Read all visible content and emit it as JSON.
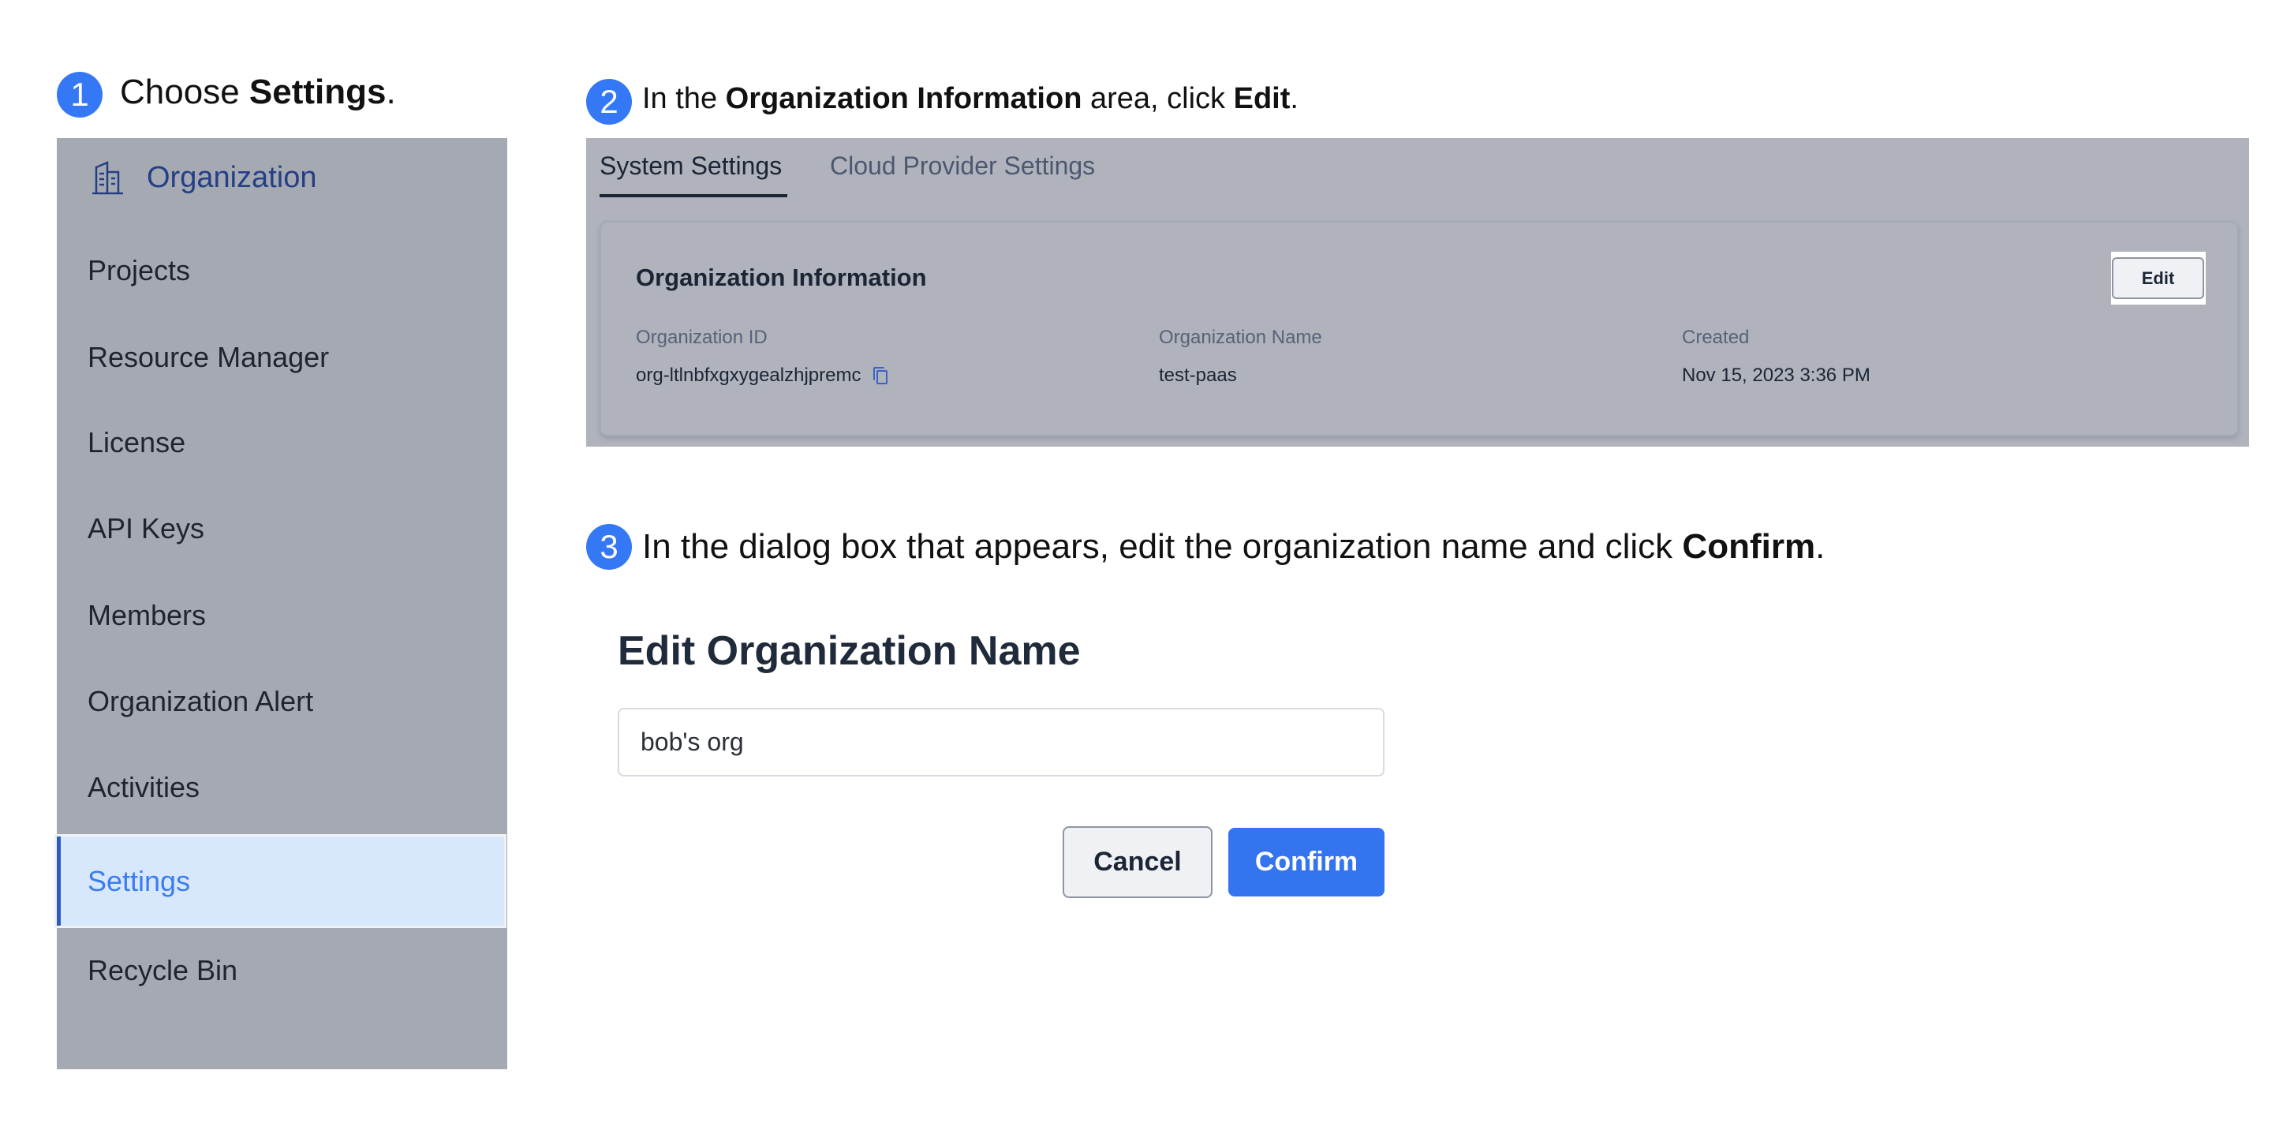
{
  "steps": [
    {
      "number": "1",
      "text_before": "Choose ",
      "bold": "Settings",
      "text_after": "."
    },
    {
      "number": "2",
      "text_before": "In the ",
      "bold": "Organization Information",
      "text_middle": " area, click ",
      "bold2": "Edit",
      "text_after": "."
    },
    {
      "number": "3",
      "text_before": "In the dialog box that appears, edit the organization name and click ",
      "bold": "Confirm",
      "text_after": "."
    }
  ],
  "sidebar": {
    "header": {
      "icon": "building-icon",
      "label": "Organization"
    },
    "items": [
      {
        "label": "Projects",
        "active": false
      },
      {
        "label": "Resource Manager",
        "active": false
      },
      {
        "label": "License",
        "active": false
      },
      {
        "label": "API Keys",
        "active": false
      },
      {
        "label": "Members",
        "active": false
      },
      {
        "label": "Organization Alert",
        "active": false
      },
      {
        "label": "Activities",
        "active": false
      },
      {
        "label": "Settings",
        "active": true
      },
      {
        "label": "Recycle Bin",
        "active": false
      }
    ]
  },
  "settings_panel": {
    "tabs": [
      {
        "label": "System Settings",
        "active": true
      },
      {
        "label": "Cloud Provider Settings",
        "active": false
      }
    ],
    "card": {
      "title": "Organization Information",
      "edit_label": "Edit",
      "fields": [
        {
          "label": "Organization ID",
          "value": "org-ltlnbfxgxygealzhjpremc",
          "copy_icon": "copy-icon"
        },
        {
          "label": "Organization Name",
          "value": "test-paas"
        },
        {
          "label": "Created",
          "value": "Nov 15, 2023 3:36 PM"
        }
      ]
    }
  },
  "dialog": {
    "title": "Edit Organization Name",
    "input_value": "bob's org",
    "cancel_label": "Cancel",
    "confirm_label": "Confirm"
  },
  "colors": {
    "accent": "#3478f6",
    "active_item_bg": "#d8e8fc",
    "active_item_text": "#3c7cf0",
    "confirm_button": "#3574ef",
    "overlay_gray": "#a5aab2"
  }
}
